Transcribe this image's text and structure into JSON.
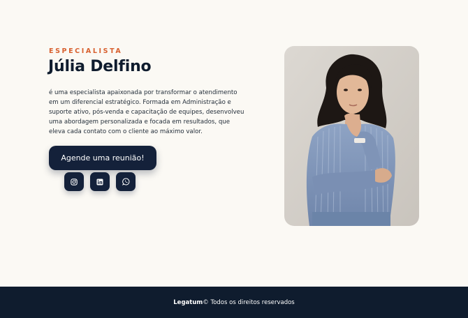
{
  "profile": {
    "eyebrow": "ESPECIALISTA",
    "name": "Júlia Delfino",
    "bio_lines": [
      "é uma especialista apaixonada por transformar o atendimento",
      "em um diferencial estratégico. Formada em Administração e",
      "suporte ativo, pós-venda e capacitação de equipes, desenvolveu",
      "uma abordagem personalizada e focada em resultados, que",
      "eleva cada contato com o cliente ao máximo valor."
    ],
    "cta_label": "Agende uma reunião!"
  },
  "socials": [
    {
      "icon": "instagram-icon"
    },
    {
      "icon": "linkedin-icon"
    },
    {
      "icon": "whatsapp-icon"
    }
  ],
  "footer": {
    "brand": "Legatum",
    "text": "© Todos os direitos reservados"
  },
  "colors": {
    "accent": "#d8602f",
    "navy": "#14213a",
    "background": "#fbf9f4"
  }
}
